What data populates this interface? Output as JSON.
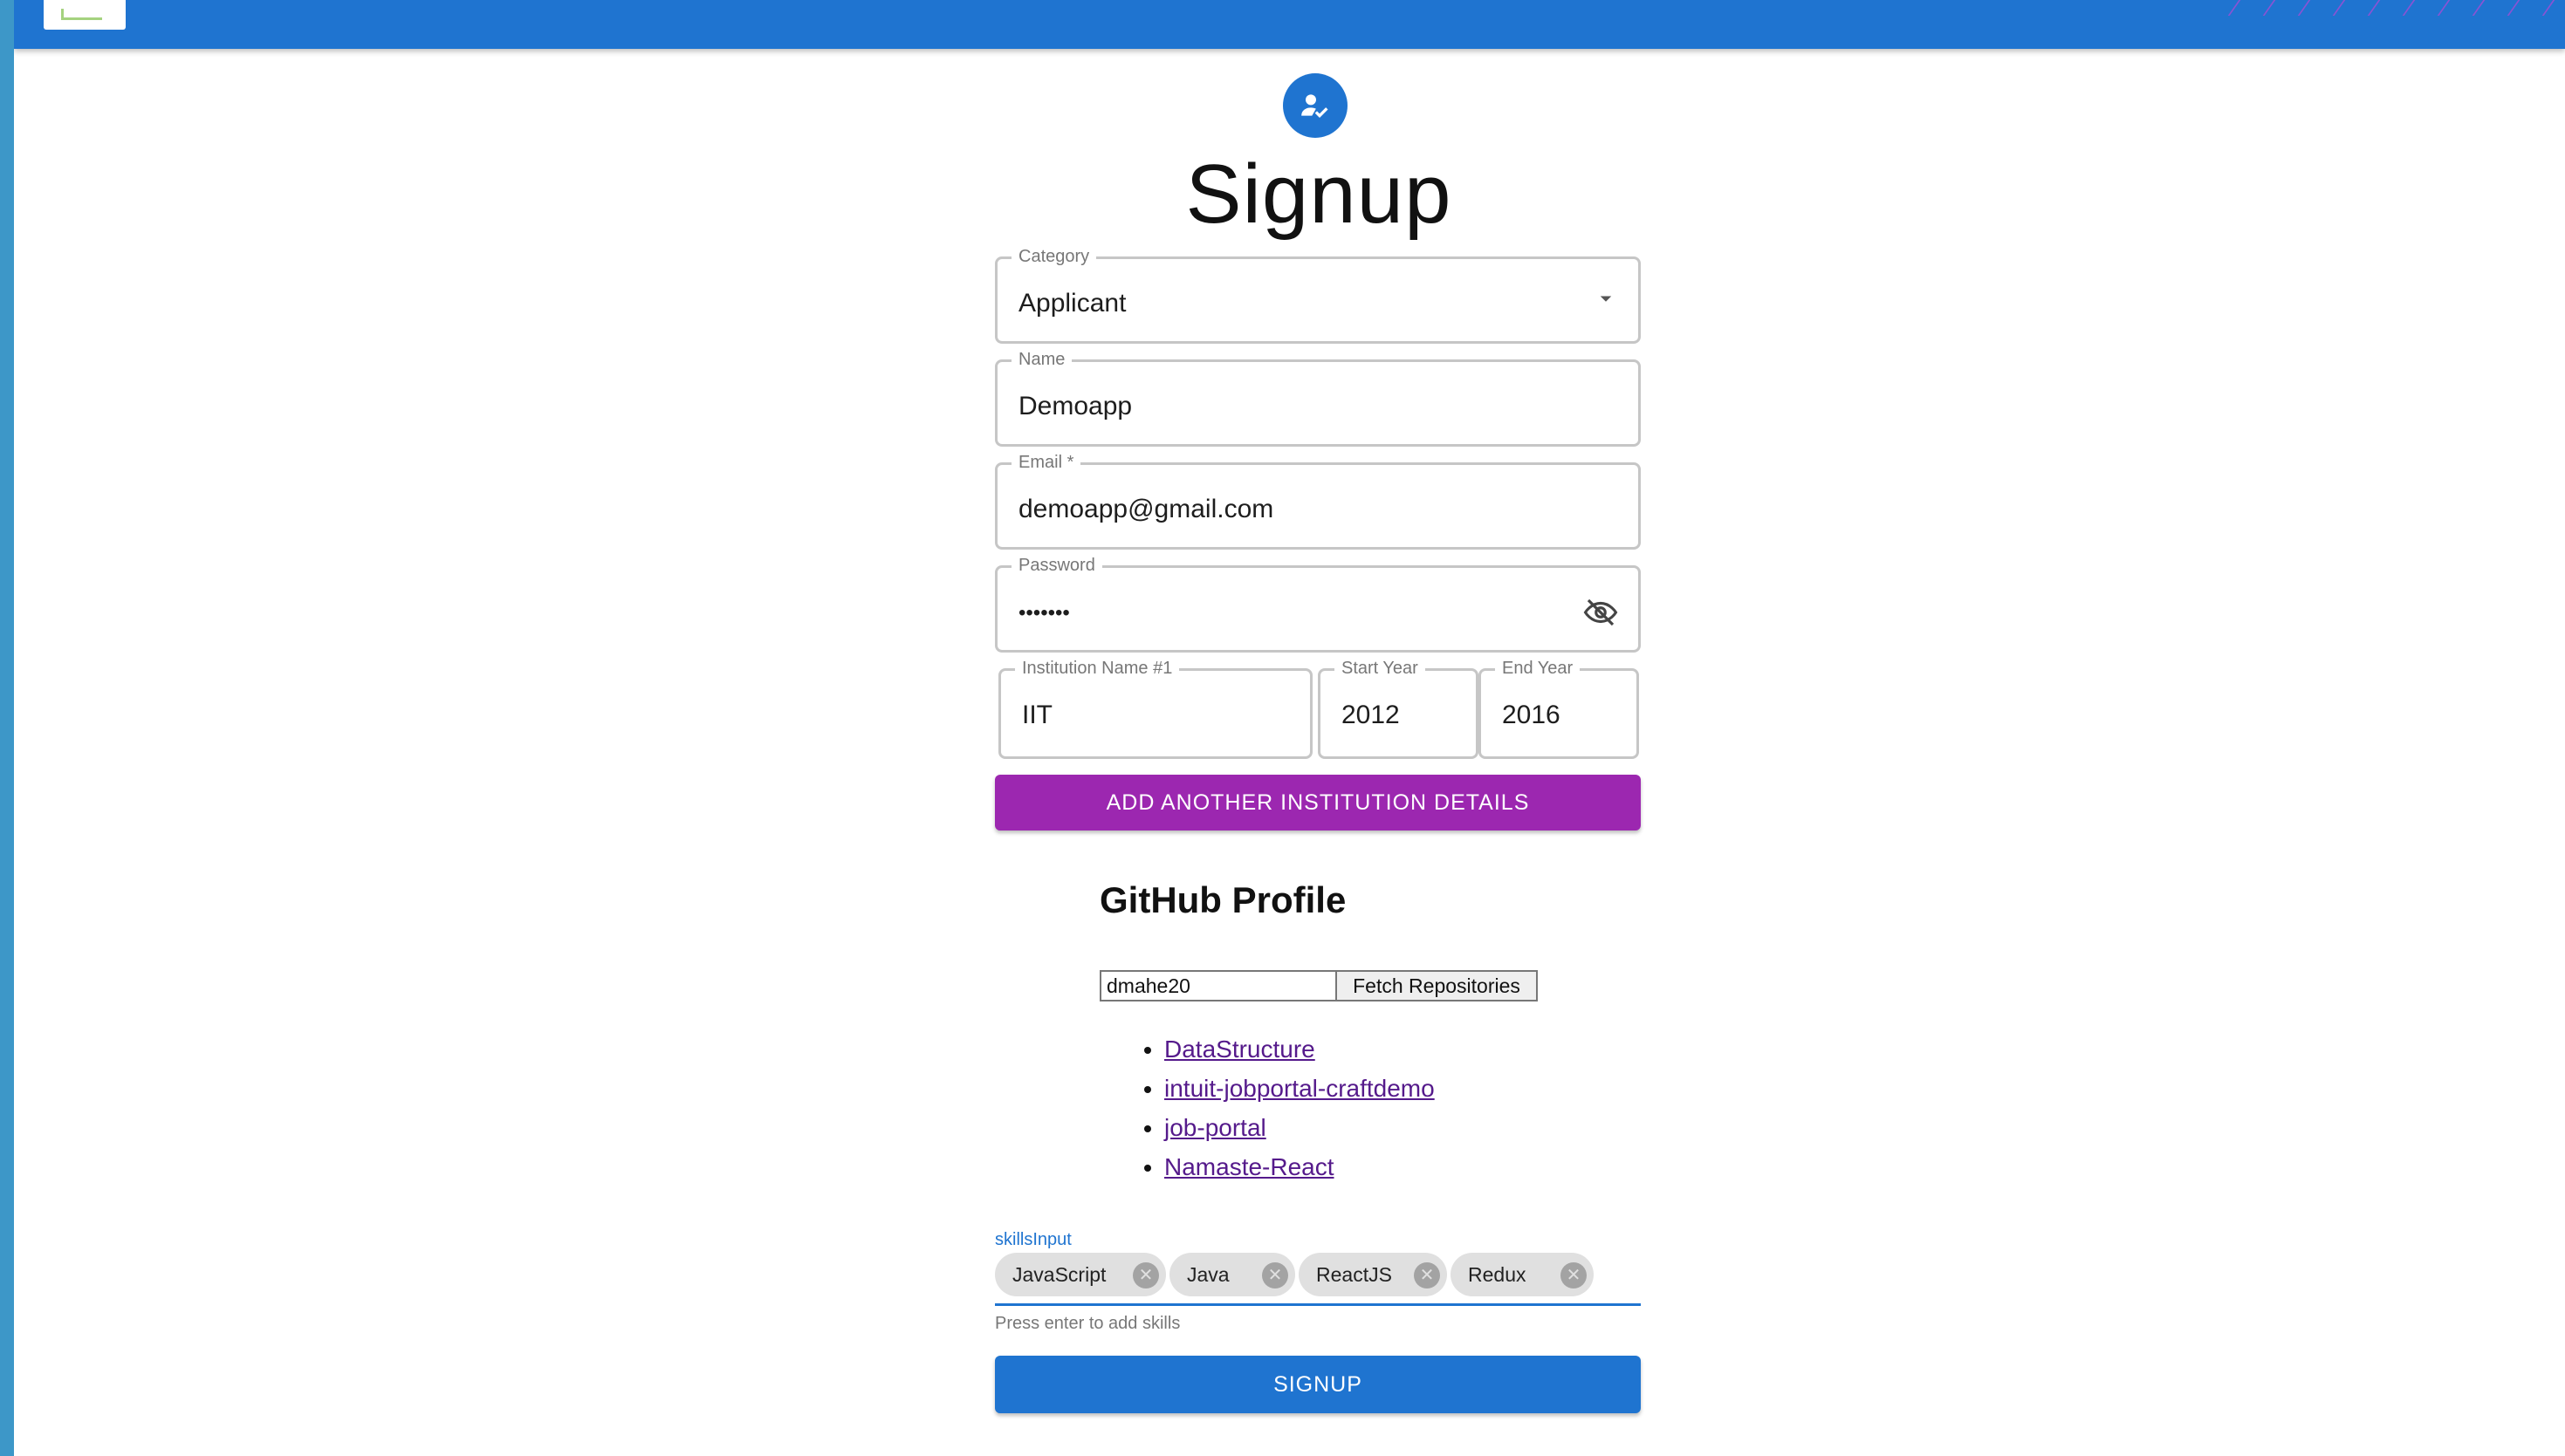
{
  "colors": {
    "primary": "#1f74d0",
    "secondary": "#9c27b0",
    "link": "#551a8b"
  },
  "page": {
    "title": "Signup",
    "avatar_icon": "person-check-icon"
  },
  "form": {
    "category": {
      "label": "Category",
      "value": "Applicant"
    },
    "name": {
      "label": "Name",
      "value": "Demoapp"
    },
    "email": {
      "label": "Email *",
      "value": "demoapp@gmail.com"
    },
    "password": {
      "label": "Password",
      "value": "•••••••",
      "toggle_icon": "visibility-off-icon"
    },
    "education": [
      {
        "institution": {
          "label": "Institution Name #1",
          "value": "IIT"
        },
        "start_year": {
          "label": "Start Year",
          "value": "2012"
        },
        "end_year": {
          "label": "End Year",
          "value": "2016"
        }
      }
    ],
    "add_institution_label": "ADD ANOTHER INSTITUTION DETAILS"
  },
  "github": {
    "title": "GitHub Profile",
    "username_value": "dmahe20",
    "fetch_label": "Fetch Repositories",
    "repos": [
      "DataStructure",
      "intuit-jobportal-craftdemo",
      "job-portal",
      "Namaste-React"
    ]
  },
  "skills": {
    "label": "skillsInput",
    "chips": [
      "JavaScript",
      "Java",
      "ReactJS",
      "Redux"
    ],
    "helper": "Press enter to add skills"
  },
  "submit_label": "SIGNUP"
}
